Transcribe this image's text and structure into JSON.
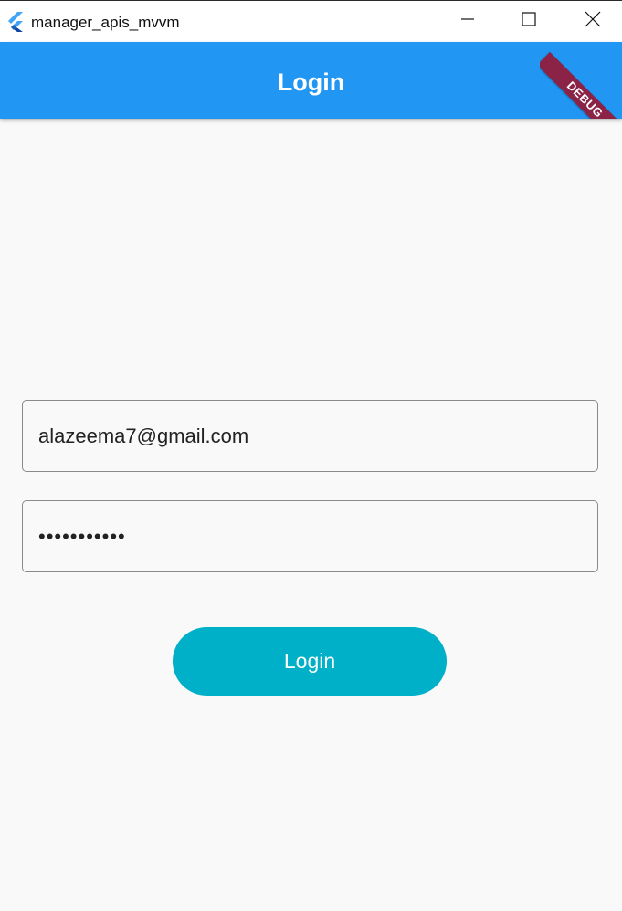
{
  "window": {
    "title": "manager_apis_mvvm",
    "icon": "flutter-logo-icon",
    "controls": [
      "minimize-icon",
      "maximize-icon",
      "close-icon"
    ]
  },
  "appbar": {
    "title": "Login",
    "debug_banner": "DEBUG"
  },
  "form": {
    "email_value": "alazeema7@gmail.com",
    "password_value": "•••••••••••",
    "login_label": "Login"
  },
  "colors": {
    "appbar": "#2196f3",
    "button": "#00b0c8",
    "background": "#f9f9f9",
    "debug_banner": "#8b2346"
  }
}
